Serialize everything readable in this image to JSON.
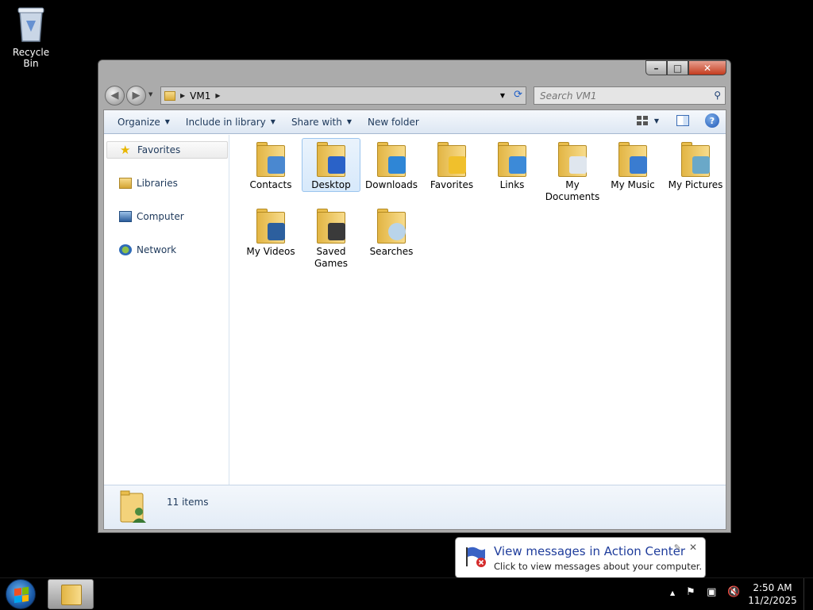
{
  "desktop": {
    "recycle_bin_label": "Recycle Bin"
  },
  "window": {
    "address": {
      "crumbs": [
        "VM1"
      ]
    },
    "search": {
      "placeholder": "Search VM1"
    },
    "toolbar": {
      "organize": "Organize",
      "include_in_library": "Include in library",
      "share_with": "Share with",
      "new_folder": "New folder"
    },
    "nav": {
      "items": [
        {
          "label": "Favorites",
          "icon": "star-icon"
        },
        {
          "label": "Libraries",
          "icon": "libraries-icon"
        },
        {
          "label": "Computer",
          "icon": "computer-icon"
        },
        {
          "label": "Network",
          "icon": "network-icon"
        }
      ]
    },
    "folders": [
      {
        "name": "Contacts",
        "icon": "contacts-folder-icon",
        "badge": "#4a88d0"
      },
      {
        "name": "Desktop",
        "icon": "desktop-folder-icon",
        "badge": "#2a62c8"
      },
      {
        "name": "Downloads",
        "icon": "downloads-folder-icon",
        "badge": "#2f86d6"
      },
      {
        "name": "Favorites",
        "icon": "favorites-folder-icon",
        "badge": "#f0c02c"
      },
      {
        "name": "Links",
        "icon": "links-folder-icon",
        "badge": "#3c8ad8"
      },
      {
        "name": "My Documents",
        "icon": "documents-folder-icon",
        "badge": "#dfe6ee"
      },
      {
        "name": "My Music",
        "icon": "music-folder-icon",
        "badge": "#3a7cd0"
      },
      {
        "name": "My Pictures",
        "icon": "pictures-folder-icon",
        "badge": "#6aa8c8"
      },
      {
        "name": "My Videos",
        "icon": "videos-folder-icon",
        "badge": "#2c5f9e"
      },
      {
        "name": "Saved Games",
        "icon": "games-folder-icon",
        "badge": "#3a3a3a"
      },
      {
        "name": "Searches",
        "icon": "searches-folder-icon",
        "badge": "#b9d4ea"
      }
    ],
    "details": {
      "count": "11 items"
    }
  },
  "balloon": {
    "title": "View messages in Action Center",
    "subtitle": "Click to view messages about your computer."
  },
  "taskbar": {
    "time": "2:50 AM",
    "date": "11/2/2025"
  }
}
